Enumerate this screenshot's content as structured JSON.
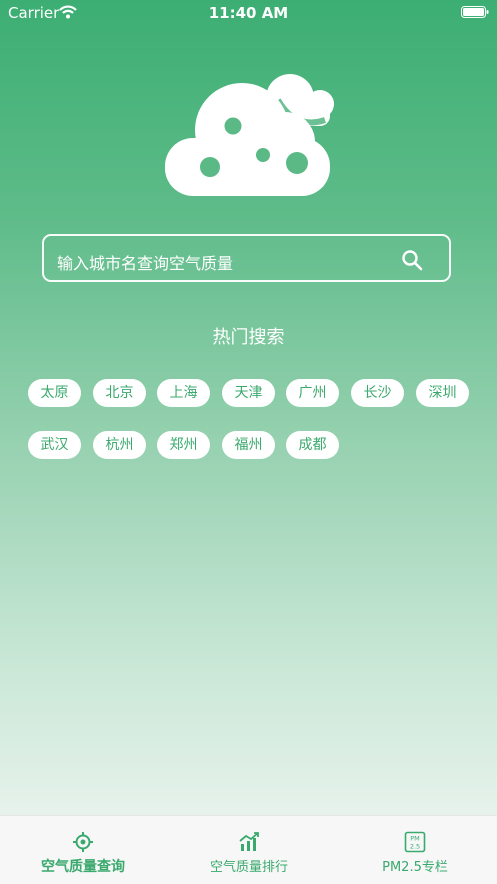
{
  "status_bar": {
    "carrier": "Carrier",
    "time": "11:40 AM"
  },
  "search": {
    "placeholder": "输入城市名查询空气质量"
  },
  "hot": {
    "title": "热门搜索",
    "cities": [
      "太原",
      "北京",
      "上海",
      "天津",
      "广州",
      "长沙",
      "深圳",
      "武汉",
      "杭州",
      "郑州",
      "福州",
      "成都"
    ]
  },
  "tabbar": {
    "items": [
      {
        "label": "空气质量查询",
        "icon": "locate-icon",
        "active": true
      },
      {
        "label": "空气质量排行",
        "icon": "chart-icon",
        "active": false
      },
      {
        "label": "PM2.5专栏",
        "icon": "pm25-icon",
        "active": false
      }
    ]
  },
  "colors": {
    "accent": "#3aa96e",
    "gradient_top": "#3cae73",
    "gradient_bottom": "#f4f7f5"
  },
  "pm_icon_text": {
    "line1": "PM",
    "line2": "2.5"
  }
}
